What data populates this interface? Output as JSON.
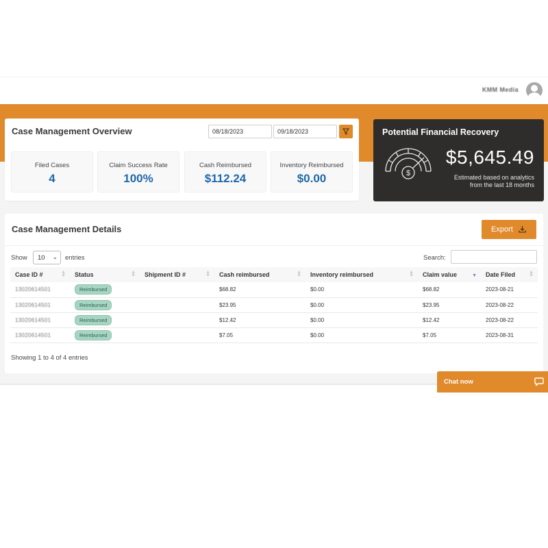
{
  "header": {
    "user_name": "KMM Media"
  },
  "overview": {
    "title": "Case Management Overview",
    "date_from": "08/18/2023",
    "date_to": "09/18/2023",
    "stats": [
      {
        "label": "Filed Cases",
        "value": "4"
      },
      {
        "label": "Claim Success Rate",
        "value": "100%"
      },
      {
        "label": "Cash Reimbursed",
        "value": "$112.24"
      },
      {
        "label": "Inventory Reimbursed",
        "value": "$0.00"
      }
    ]
  },
  "recovery": {
    "title": "Potential Financial Recovery",
    "amount": "$5,645.49",
    "note_line1": "Estimated based on analytics",
    "note_line2": "from the last 18 months"
  },
  "details": {
    "title": "Case Management Details",
    "export_label": "Export",
    "show_label": "Show",
    "entries_value": "10",
    "entries_label": "entries",
    "search_label": "Search:",
    "columns": [
      "Case ID #",
      "Status",
      "Shipment ID #",
      "Cash reimbursed",
      "Inventory reimbursed",
      "Claim value",
      "Date Filed"
    ],
    "rows": [
      {
        "case_id": "13020614501",
        "status": "Reimbursed",
        "shipment_id": "",
        "cash": "$68.82",
        "inventory": "$0.00",
        "claim": "$68.82",
        "date": "2023-08-21"
      },
      {
        "case_id": "13020614501",
        "status": "Reimbursed",
        "shipment_id": "",
        "cash": "$23.95",
        "inventory": "$0.00",
        "claim": "$23.95",
        "date": "2023-08-22"
      },
      {
        "case_id": "13020614501",
        "status": "Reimbursed",
        "shipment_id": "",
        "cash": "$12.42",
        "inventory": "$0.00",
        "claim": "$12.42",
        "date": "2023-08-22"
      },
      {
        "case_id": "13020614501",
        "status": "Reimbursed",
        "shipment_id": "",
        "cash": "$7.05",
        "inventory": "$0.00",
        "claim": "$7.05",
        "date": "2023-08-31"
      }
    ],
    "footer": "Showing 1 to 4 of 4 entries"
  },
  "chat": {
    "label": "Chat now"
  },
  "colors": {
    "accent": "#e08a2c",
    "dark_card": "#2f2d2c",
    "stat_value": "#1f68a8",
    "badge_bg": "#a8d5c3"
  },
  "icons": [
    "user-avatar-icon",
    "filter-icon",
    "gauge-dollar-icon",
    "download-icon",
    "sort-icon",
    "chat-bubble-icon"
  ]
}
